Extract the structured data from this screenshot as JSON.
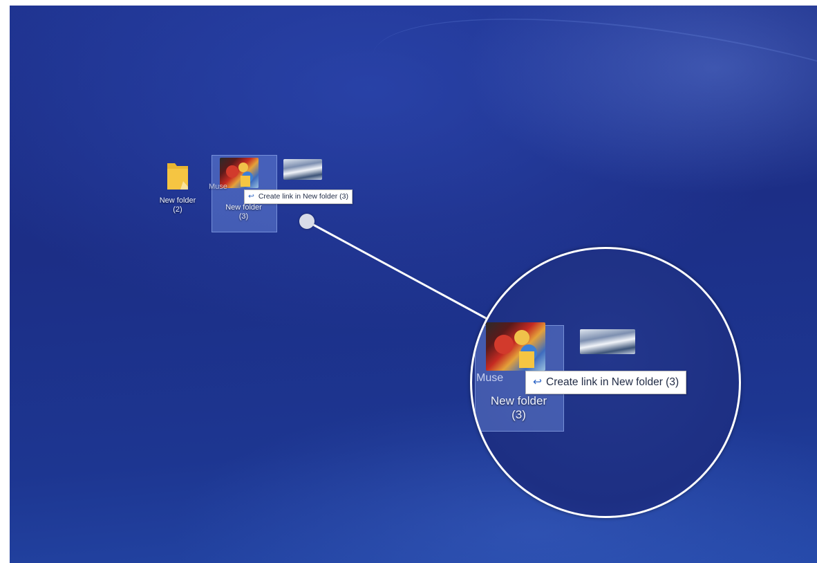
{
  "desktop": {
    "icons": [
      {
        "label_line1": "New folder",
        "label_line2": "(2)"
      },
      {
        "label_line1": "New folder",
        "label_line2": "(3)"
      }
    ],
    "partial_label": "Muse",
    "tooltip_text": "Create link in New folder (3)",
    "link_glyph": "↩"
  },
  "magnifier": {
    "label_line1": "New folder",
    "label_line2": "(3)",
    "partial_label": "Muse",
    "tooltip_text": "Create link in New folder (3)"
  },
  "colors": {
    "desktop_background": "#1e328e",
    "selection": "#7896e6",
    "folder_yellow": "#f5c542",
    "tooltip_accent": "#2b64c5"
  },
  "icons_used": [
    "folder-icon",
    "photo-thumbnail-icon",
    "landscape-thumbnail-icon",
    "link-icon"
  ]
}
